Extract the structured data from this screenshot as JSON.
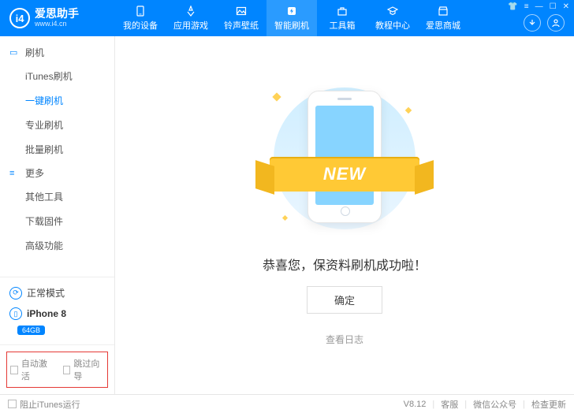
{
  "brand": {
    "name": "爱思助手",
    "url": "www.i4.cn"
  },
  "top_tabs": [
    {
      "label": "我的设备"
    },
    {
      "label": "应用游戏"
    },
    {
      "label": "铃声壁纸"
    },
    {
      "label": "智能刷机"
    },
    {
      "label": "工具箱"
    },
    {
      "label": "教程中心"
    },
    {
      "label": "爱思商城"
    }
  ],
  "sidebar": {
    "section1": {
      "title": "刷机",
      "items": [
        "iTunes刷机",
        "一键刷机",
        "专业刷机",
        "批量刷机"
      ]
    },
    "section2": {
      "title": "更多",
      "items": [
        "其他工具",
        "下载固件",
        "高级功能"
      ]
    },
    "mode": "正常模式",
    "device": {
      "name": "iPhone 8",
      "storage": "64GB"
    },
    "auto_activate": "自动激活",
    "skip_wizard": "跳过向导"
  },
  "content": {
    "ribbon": "NEW",
    "success_text": "恭喜您，保资料刷机成功啦！",
    "ok_button": "确定",
    "log_link": "查看日志"
  },
  "statusbar": {
    "block_itunes": "阻止iTunes运行",
    "version": "V8.12",
    "support": "客服",
    "wechat": "微信公众号",
    "check_update": "检查更新"
  }
}
